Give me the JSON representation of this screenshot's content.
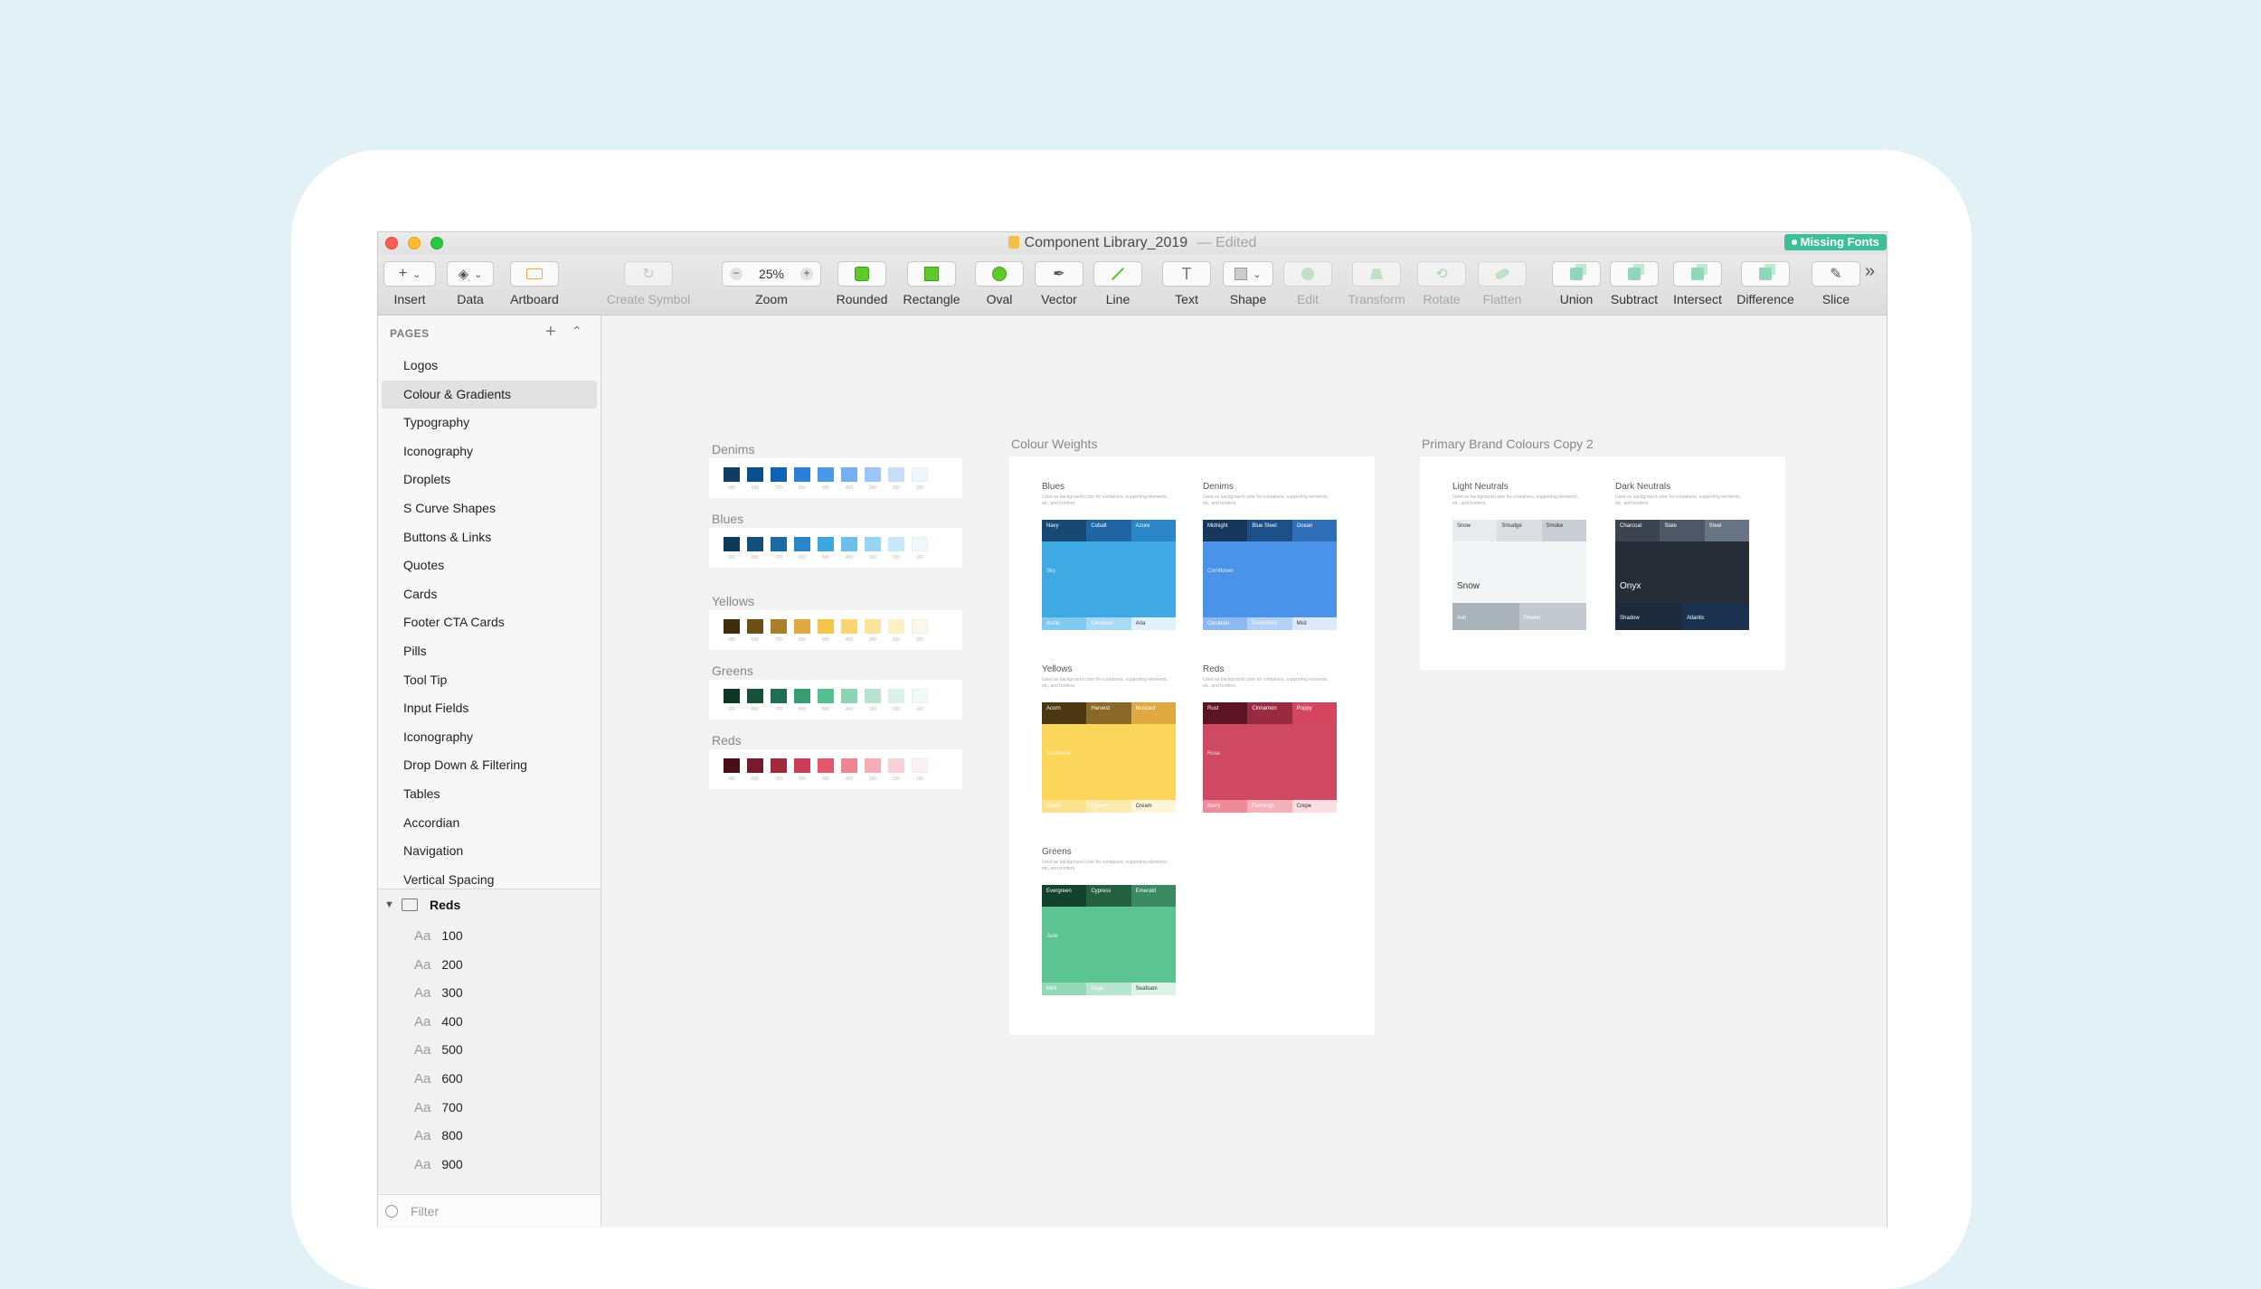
{
  "window": {
    "title": "Component Library_2019",
    "status": "Edited",
    "missing_fonts": "Missing Fonts"
  },
  "toolbar": {
    "insert": "Insert",
    "data": "Data",
    "artboard": "Artboard",
    "create_symbol": "Create Symbol",
    "zoom_label": "Zoom",
    "zoom_value": "25%",
    "rounded": "Rounded",
    "rectangle": "Rectangle",
    "oval": "Oval",
    "vector": "Vector",
    "line": "Line",
    "text": "Text",
    "shape": "Shape",
    "edit": "Edit",
    "transform": "Transform",
    "rotate": "Rotate",
    "flatten": "Flatten",
    "union": "Union",
    "subtract": "Subtract",
    "intersect": "Intersect",
    "difference": "Difference",
    "slice": "Slice",
    "more": "»"
  },
  "sidebar": {
    "pages_header": "PAGES",
    "pages": [
      "Logos",
      "Colour & Gradients",
      "Typography",
      "Iconography",
      "Droplets",
      "S Curve Shapes",
      "Buttons & Links",
      "Quotes",
      "Cards",
      "Footer CTA Cards",
      "Pills",
      "Tool Tip",
      "Input Fields",
      "Iconography",
      "Drop Down & Filtering",
      "Tables",
      "Accordian",
      "Navigation",
      "Vertical Spacing"
    ],
    "selected_page": "Colour & Gradients",
    "group_label": "Reds",
    "aa": "Aa",
    "layers": [
      "100",
      "200",
      "300",
      "400",
      "500",
      "600",
      "700",
      "800",
      "900"
    ],
    "filter_placeholder": "Filter"
  },
  "canvas": {
    "palettes": [
      {
        "name": "Denims",
        "colors": [
          "#0f3d66",
          "#0d4f8c",
          "#0e63b5",
          "#2a7fd6",
          "#4b98e6",
          "#74aff0",
          "#9cc6f5",
          "#c7def9",
          "#eef5fd"
        ]
      },
      {
        "name": "Blues",
        "colors": [
          "#0e3a5a",
          "#124f7a",
          "#1d6aa0",
          "#2a86c6",
          "#3ea6e0",
          "#6cc0ec",
          "#98d4f3",
          "#c7e8f9",
          "#eef8fd"
        ]
      },
      {
        "name": "Yellows",
        "colors": [
          "#3e2c0c",
          "#6b4f17",
          "#a97f2d",
          "#e0a93f",
          "#f5c44c",
          "#fad672",
          "#fce39c",
          "#fdefc6",
          "#fff8ea"
        ]
      },
      {
        "name": "Greens",
        "colors": [
          "#0f3524",
          "#155238",
          "#1f6e4f",
          "#3a9c73",
          "#57bf90",
          "#8ed4b4",
          "#b8e4cf",
          "#daf2e6",
          "#f1fbf6"
        ]
      },
      {
        "name": "Reds",
        "colors": [
          "#4a0d1a",
          "#761a2c",
          "#a3293f",
          "#cc3b53",
          "#e5566c",
          "#ef8593",
          "#f5aeb8",
          "#fad1d7",
          "#fdf0f2"
        ]
      }
    ],
    "swatch_labels": [
      "900",
      "800",
      "700",
      "600",
      "500",
      "400",
      "300",
      "200",
      "100"
    ],
    "colour_weights_title": "Colour Weights",
    "primary_brand_title": "Primary Brand Colours Copy 2",
    "weights": [
      {
        "name": "Blues",
        "desc": "Used as background color for containers, supporting elements, etc, and borders.",
        "top": [
          "Navy",
          "Cobalt",
          "Azure"
        ],
        "main": "Sky",
        "bottom": [
          "Arctic",
          "Cerulean",
          "Aria"
        ],
        "top_colors": [
          "#164a74",
          "#1d65a3",
          "#2a86c6"
        ],
        "main_color": "#3ea9e2",
        "bottom_colors": [
          "#82c9ef",
          "#a8daf5",
          "#dff1fb"
        ]
      },
      {
        "name": "Denims",
        "desc": "Used as background color for containers, supporting elements, etc, and borders.",
        "top": [
          "Midnight",
          "Blue Steel",
          "Ocean"
        ],
        "main": "Cornflower",
        "bottom": [
          "Cerulean",
          "Periwinkle",
          "Mist"
        ],
        "top_colors": [
          "#15385c",
          "#1d5089",
          "#2e6fb8"
        ],
        "main_color": "#4b93e9",
        "bottom_colors": [
          "#8cb9f1",
          "#b4d1f6",
          "#dde9fb"
        ]
      },
      {
        "name": "Yellows",
        "desc": "Used as background color for containers, supporting elements, etc, and borders.",
        "top": [
          "Acorn",
          "Harvest",
          "Mustard"
        ],
        "main": "Sunflower",
        "bottom": [
          "Maize",
          "Canary",
          "Cream"
        ],
        "top_colors": [
          "#4b3712",
          "#8a6828",
          "#dfa93f"
        ],
        "main_color": "#fcd65a",
        "bottom_colors": [
          "#fde28c",
          "#fdeab0",
          "#fff5da"
        ]
      },
      {
        "name": "Reds",
        "desc": "Used as background color for containers, supporting elements, etc, and borders.",
        "top": [
          "Rust",
          "Cinnamon",
          "Poppy"
        ],
        "main": "Rose",
        "bottom": [
          "Berry",
          "Flamingo",
          "Crepe"
        ],
        "top_colors": [
          "#5c1324",
          "#9a2a3f",
          "#d64560"
        ],
        "main_color": "#d04963",
        "bottom_colors": [
          "#ef8a9a",
          "#f5b0bc",
          "#fbdde2"
        ]
      },
      {
        "name": "Greens",
        "desc": "Used as background color for containers, supporting elements, etc, and borders.",
        "top": [
          "Evergreen",
          "Cypress",
          "Emerald"
        ],
        "main": "Jade",
        "bottom": [
          "Mint",
          "Sage",
          "Seafoam"
        ],
        "top_colors": [
          "#13432d",
          "#23603f",
          "#3a8a63"
        ],
        "main_color": "#5cc493",
        "bottom_colors": [
          "#93d8b7",
          "#b8e5cf",
          "#ddf3e8"
        ]
      }
    ],
    "neutrals": [
      {
        "name": "Light Neutrals",
        "desc": "Used as background color for containers, supporting elements, etc, and borders.",
        "top": [
          "Snow",
          "Smudge",
          "Smoke"
        ],
        "main": "Snow",
        "bottom": [
          "Ash",
          "Pewter"
        ],
        "top_colors": [
          "#e8ebee",
          "#dadee2",
          "#c9ced4"
        ],
        "main_color": "#f3f5f7",
        "bottom_colors": [
          "#aab2ba",
          "#c3c9cf"
        ],
        "dark": false
      },
      {
        "name": "Dark Neutrals",
        "desc": "Used as background color for containers, supporting elements, etc, and borders.",
        "top": [
          "Charcoal",
          "Slate",
          "Steel"
        ],
        "main": "Onyx",
        "bottom": [
          "Shadow",
          "Atlantic"
        ],
        "top_colors": [
          "#3b4450",
          "#4d5765",
          "#687383"
        ],
        "main_color": "#262d36",
        "bottom_colors": [
          "#1c2a3c",
          "#1a3150"
        ],
        "dark": true
      }
    ]
  }
}
